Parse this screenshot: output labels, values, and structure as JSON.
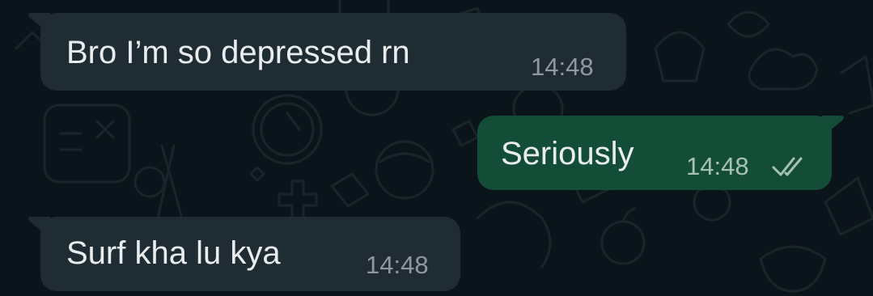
{
  "chat": {
    "messages": [
      {
        "direction": "incoming",
        "text": "Bro I’m so depressed rn",
        "time": "14:48"
      },
      {
        "direction": "outgoing",
        "text": "Seriously",
        "time": "14:48",
        "status": "read",
        "status_icon": "double-check-icon"
      },
      {
        "direction": "incoming",
        "text": "Surf kha lu kya",
        "time": "14:48"
      }
    ]
  },
  "theme": {
    "background": "#0b141a",
    "incoming_bubble": "#202c33",
    "outgoing_bubble": "#144d37",
    "text_color": "#e9edef",
    "time_color": "#8e989d"
  }
}
